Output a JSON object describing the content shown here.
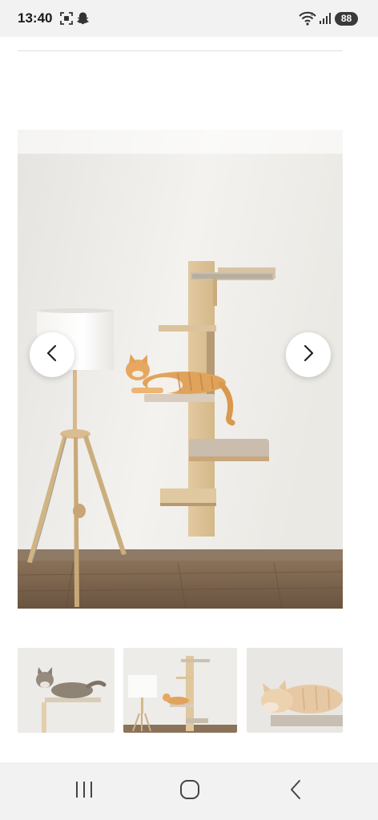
{
  "status_bar": {
    "time": "13:40",
    "battery": "88",
    "icons": [
      "screenshot-icon",
      "snapchat-icon",
      "wifi-icon",
      "signal-icon",
      "battery-icon"
    ]
  },
  "gallery": {
    "main_image": "cat-wall-shelves-photo",
    "prev_icon": "chevron-left-icon",
    "next_icon": "chevron-right-icon",
    "thumbnails": [
      "tabby-cat-on-shelf-thumbnail",
      "cat-wall-shelves-thumbnail",
      "sleeping-cat-thumbnail"
    ]
  },
  "navigation_bar": {
    "keys": [
      "recent-apps-icon",
      "home-icon",
      "back-icon"
    ]
  }
}
